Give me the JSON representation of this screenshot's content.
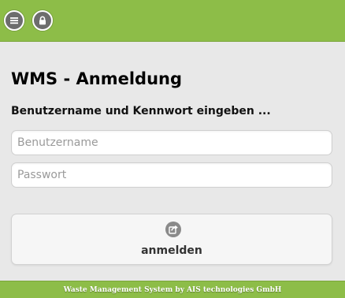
{
  "header": {
    "menu_icon": "hamburger-menu-icon",
    "lock_icon": "lock-icon"
  },
  "page": {
    "title": "WMS - Anmeldung",
    "subtitle": "Benutzername und Kennwort eingeben ..."
  },
  "form": {
    "username_placeholder": "Benutzername",
    "username_value": "",
    "password_placeholder": "Passwort",
    "password_value": ""
  },
  "login_button": {
    "icon": "login-share-icon",
    "label": "anmelden"
  },
  "footer": {
    "text": "Waste Management System by AIS technologies GmbH"
  },
  "colors": {
    "accent": "#8dbd48",
    "background": "#e8e8e8",
    "icon_bg": "#6d6d6d"
  }
}
